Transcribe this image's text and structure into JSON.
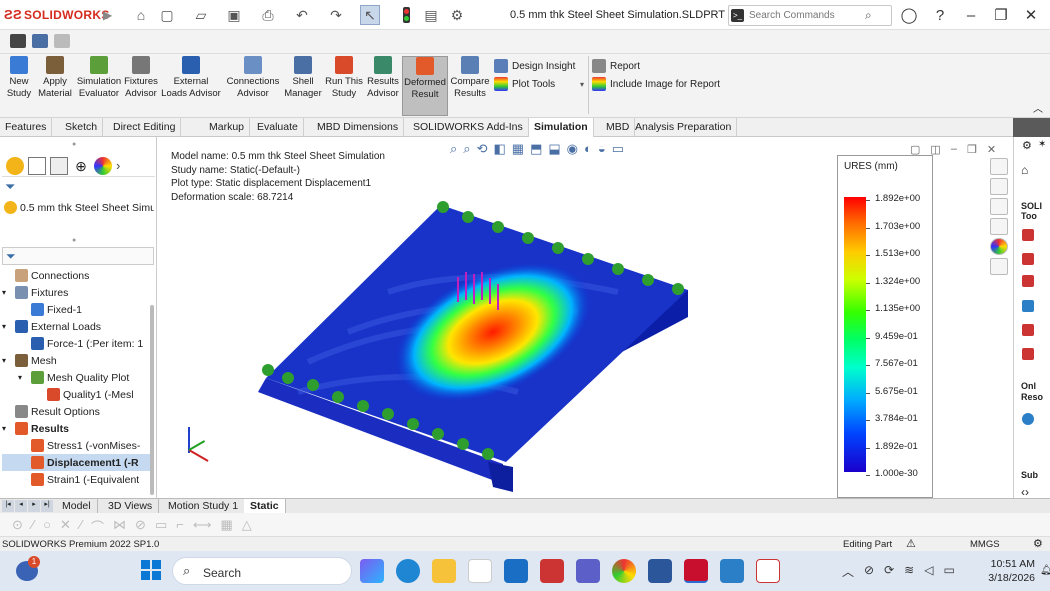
{
  "app": {
    "brand": "SOLIDWORKS",
    "title": "0.5 mm thk Steel Sheet Simulation.SLDPRT *",
    "search_placeholder": "Search Commands"
  },
  "ribbon": {
    "buttons": [
      {
        "label": "New\nStudy",
        "icon": "new-study-icon"
      },
      {
        "label": "Apply\nMaterial",
        "icon": "apply-material-icon"
      },
      {
        "label": "Simulation\nEvaluator",
        "icon": "simulation-evaluator-icon"
      },
      {
        "label": "Fixtures\nAdvisor",
        "icon": "fixtures-advisor-icon"
      },
      {
        "label": "External\nLoads Advisor",
        "icon": "external-loads-icon"
      },
      {
        "label": "Connections\nAdvisor",
        "icon": "connections-advisor-icon"
      },
      {
        "label": "Shell\nManager",
        "icon": "shell-manager-icon"
      },
      {
        "label": "Run This\nStudy",
        "icon": "run-study-icon"
      },
      {
        "label": "Results\nAdvisor",
        "icon": "results-advisor-icon"
      },
      {
        "label": "Deformed\nResult",
        "icon": "deformed-result-icon"
      },
      {
        "label": "Compare\nResults",
        "icon": "compare-results-icon"
      }
    ],
    "design_insight": "Design Insight",
    "plot_tools": "Plot Tools",
    "report": "Report",
    "include_image": "Include Image for Report"
  },
  "tabs": [
    "Features",
    "Sketch",
    "Direct Editing",
    "Markup",
    "Evaluate",
    "MBD Dimensions",
    "SOLIDWORKS Add-Ins",
    "Simulation",
    "MBD",
    "Analysis Preparation"
  ],
  "active_tab": "Simulation",
  "tree": {
    "study": "0.5 mm thk Steel Sheet Simu",
    "items": [
      {
        "label": "Connections",
        "indent": 1
      },
      {
        "label": "Fixtures",
        "indent": 1
      },
      {
        "label": "Fixed-1",
        "indent": 2
      },
      {
        "label": "External Loads",
        "indent": 1
      },
      {
        "label": "Force-1 (:Per item: 1",
        "indent": 2
      },
      {
        "label": "Mesh",
        "indent": 1
      },
      {
        "label": "Mesh Quality Plot",
        "indent": 2
      },
      {
        "label": "Quality1 (-Mesl",
        "indent": 3
      },
      {
        "label": "Result Options",
        "indent": 1
      },
      {
        "label": "Results",
        "indent": 1
      },
      {
        "label": "Stress1 (-vonMises-",
        "indent": 2
      },
      {
        "label": "Displacement1 (-R",
        "indent": 2
      },
      {
        "label": "Strain1 (-Equivalent",
        "indent": 2
      }
    ]
  },
  "viewport_info": {
    "line1": "Model name: 0.5 mm thk Steel Sheet Simulation",
    "line2": "Study name: Static(-Default-)",
    "line3": "Plot type: Static displacement Displacement1",
    "line4": "Deformation scale: 68.7214"
  },
  "legend": {
    "title": "URES (mm)",
    "values": [
      "1.892e+00",
      "1.703e+00",
      "1.513e+00",
      "1.324e+00",
      "1.135e+00",
      "9.459e-01",
      "7.567e-01",
      "5.675e-01",
      "3.784e-01",
      "1.892e-01",
      "1.000e-30"
    ]
  },
  "right_panel": {
    "items": [
      "SOLI",
      "Too",
      "Onl",
      "Reso",
      "Sub"
    ]
  },
  "bottom_tabs": [
    "Model",
    "3D Views",
    "Motion Study 1",
    "Static"
  ],
  "active_bottom_tab": "Static",
  "status": {
    "left": "SOLIDWORKS Premium 2022 SP1.0",
    "mode": "Editing Part",
    "units": "MMGS"
  },
  "taskbar": {
    "search": "Search",
    "time": "10:51 AM",
    "date": "3/18/2026",
    "notification_badge": "1"
  },
  "colors": {
    "brand_red": "#d52b1e",
    "selected": "#c5d9f1",
    "taskbar": "#dfe7f3"
  }
}
